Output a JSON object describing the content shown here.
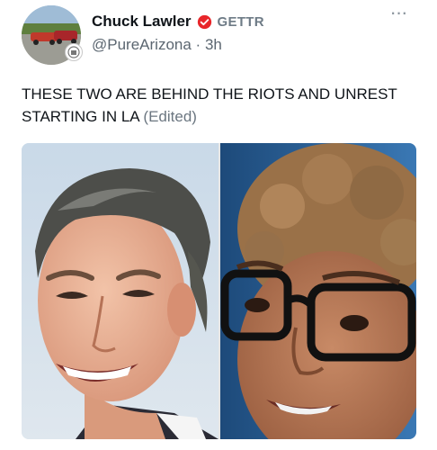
{
  "author": {
    "display_name": "Chuck Lawler",
    "platform": "GETTR",
    "handle": "@PureArizona",
    "separator": "·",
    "time_ago": "3h",
    "badge_icon": "gettr-verified-icon",
    "badge_color": "#e8262a"
  },
  "menu": {
    "more_label": "···"
  },
  "post": {
    "text": "THESE TWO ARE BEHIND THE RIOTS AND UNREST STARTING IN LA",
    "edited_label": "(Edited)"
  },
  "media": {
    "left_panel": "photo-man-smiling",
    "right_panel": "photo-woman-glasses"
  },
  "colors": {
    "text_primary": "#0f1419",
    "text_secondary": "#5b6670",
    "accent_red": "#e8262a"
  }
}
